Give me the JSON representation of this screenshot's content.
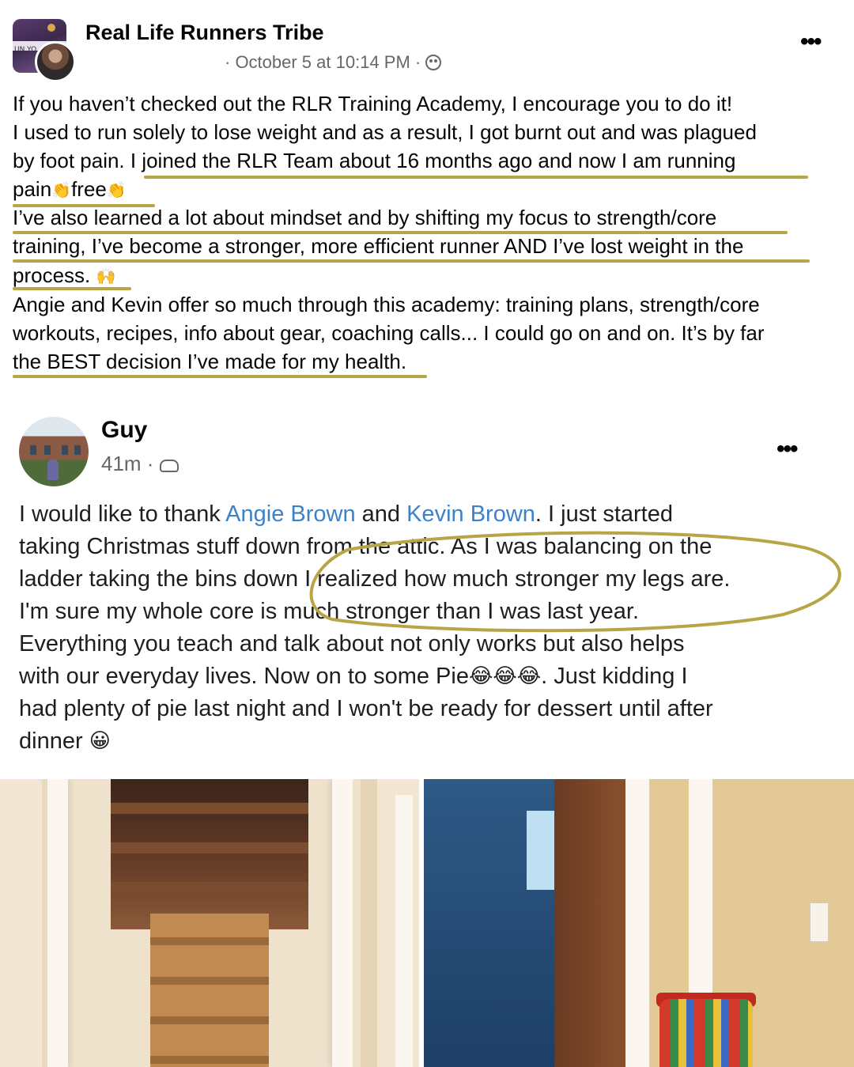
{
  "post1": {
    "group_name": "Real Life Runners Tribe",
    "avatar_text": "UN YO",
    "meta": "· October 5 at 10:14 PM ·",
    "more_label": "•••",
    "lines": [
      "If you haven’t checked out the RLR Training Academy, I encourage you to do it!",
      "I used to run solely to lose weight and as a result, I got burnt out and was plagued",
      "by foot pain. I joined the RLR Team about 16 months ago and now I am running",
      "I’ve also learned a lot about mindset and by shifting my focus to strength/core",
      "training, I’ve become a stronger, more efficient runner AND I’ve lost weight in the",
      "Angie and Kevin offer so much through this academy: training plans, strength/core",
      "workouts, recipes, info about gear, coaching calls... I could go on and on. It’s by far",
      "the BEST decision I’ve made for my health."
    ],
    "line4": {
      "a": "pain",
      "b": "free"
    },
    "line7": "process.",
    "emojis": {
      "clap": "👏",
      "raised": "🙌"
    },
    "highlight_color": "#b7a546"
  },
  "post2": {
    "author": "Guy",
    "meta": "41m ·",
    "more_label": "•••",
    "line1": {
      "a": "I would like to thank ",
      "m1": "Angie Brown",
      "b": " and ",
      "m2": "Kevin Brown",
      "c": ". I just started"
    },
    "lines": [
      "taking Christmas stuff down from the attic. As I was balancing on the",
      "ladder taking the bins down I realized how much stronger my legs are.",
      "I'm sure my whole core is much stronger than I was last year.",
      "Everything you teach and talk about not only works but also helps"
    ],
    "line6": {
      "a": "with our everyday lives. Now on to some Pie",
      "b": ". Just kidding I"
    },
    "line7": "had plenty of pie last night and I won't be ready for dessert until after",
    "line8": "dinner",
    "emojis": {
      "laugh": "😂",
      "grin": "😀"
    },
    "mention_color": "#3b82c8",
    "circle_color": "#b7a546"
  }
}
